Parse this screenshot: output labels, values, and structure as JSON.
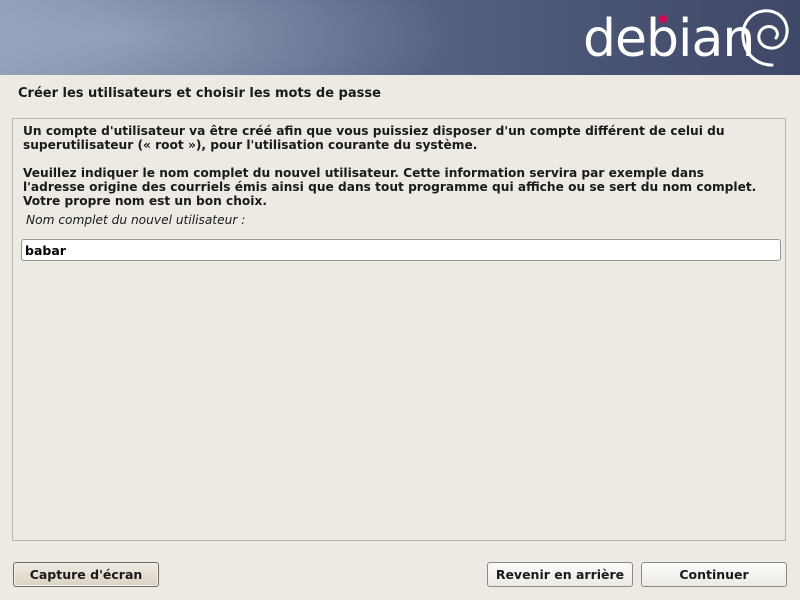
{
  "header": {
    "logo_text": "debian",
    "accent_dot_color": "#d70751"
  },
  "page": {
    "title": "Créer les utilisateurs et choisir les mots de passe",
    "paragraph1": "Un compte d'utilisateur va être créé afin que vous puissiez disposer d'un compte différent de celui du superutilisateur (« root »), pour l'utilisation courante du système.",
    "paragraph2": "Veuillez indiquer le nom complet du nouvel utilisateur. Cette information servira par exemple dans l'adresse origine des courriels émis ainsi que dans tout programme qui affiche ou se sert du nom complet. Votre propre nom est un bon choix.",
    "field_label": "Nom complet du nouvel utilisateur :",
    "field_value": "babar"
  },
  "buttons": {
    "screenshot": "Capture d'écran",
    "back": "Revenir en arrière",
    "continue": "Continuer"
  }
}
